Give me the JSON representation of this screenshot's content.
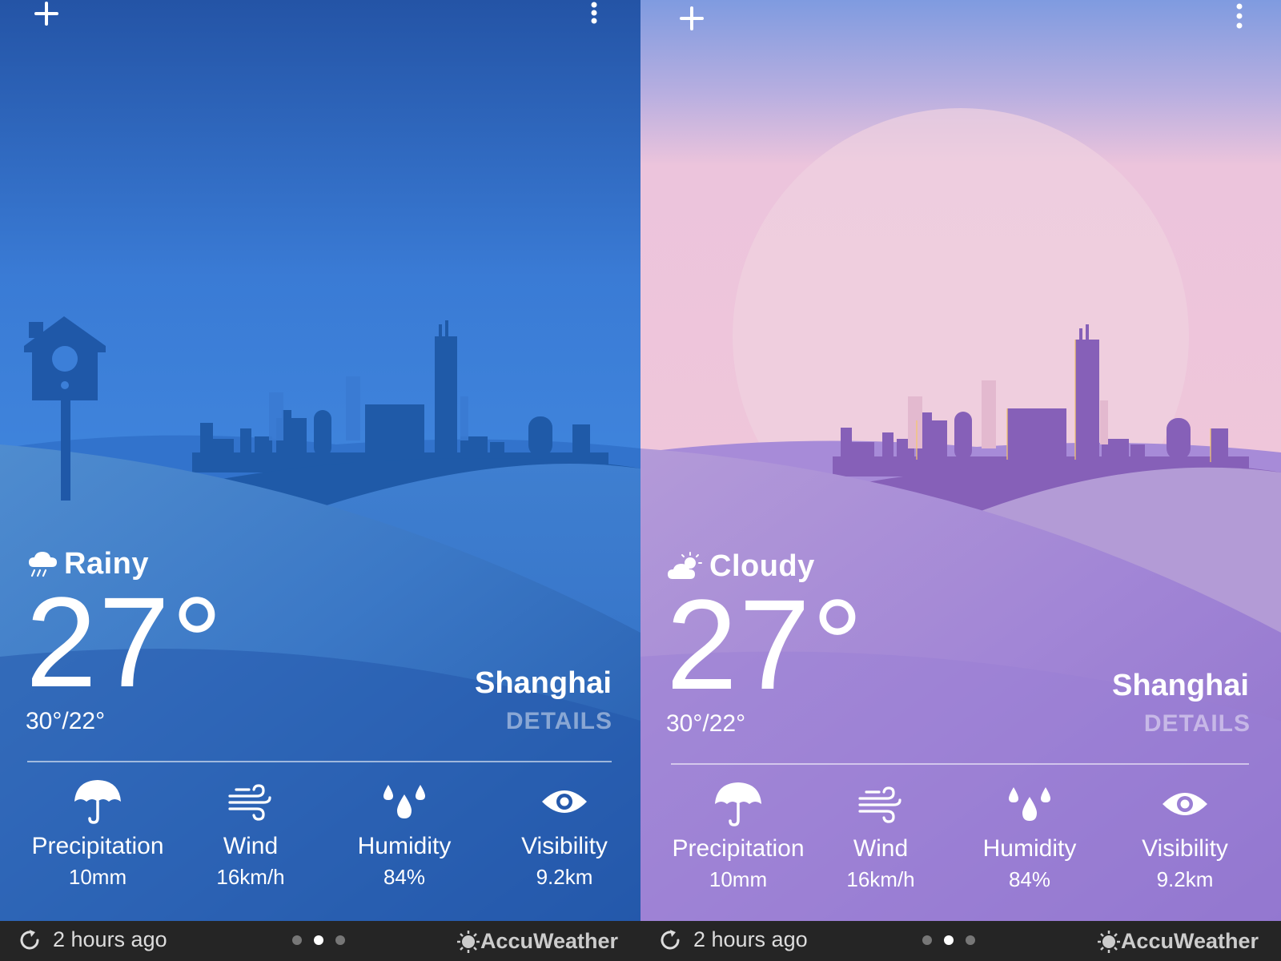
{
  "screens": [
    {
      "condition": "Rainy",
      "condition_icon": "rain-cloud-icon",
      "temperature": "27°",
      "high_low": "30°/22°",
      "city": "Shanghai",
      "details_label": "DETAILS",
      "metrics": [
        {
          "label": "Precipitation",
          "value": "10mm",
          "icon": "umbrella-icon"
        },
        {
          "label": "Wind",
          "value": "16km/h",
          "icon": "wind-icon"
        },
        {
          "label": "Humidity",
          "value": "84%",
          "icon": "humidity-icon"
        },
        {
          "label": "Visibility",
          "value": "9.2km",
          "icon": "eye-icon"
        }
      ],
      "footer": {
        "updated": "2 hours ago",
        "brand": "AccuWeather",
        "page_dots": 3,
        "active_dot": 2
      },
      "colors": {
        "sky_top": "#2454a6",
        "sky_mid": "#3f84dc",
        "hill": "#2a65b9",
        "city": "#1f5aa8",
        "footer": "#252525"
      }
    },
    {
      "condition": "Cloudy",
      "condition_icon": "partly-cloudy-icon",
      "temperature": "27°",
      "high_low": "30°/22°",
      "city": "Shanghai",
      "details_label": "DETAILS",
      "metrics": [
        {
          "label": "Precipitation",
          "value": "10mm",
          "icon": "umbrella-icon"
        },
        {
          "label": "Wind",
          "value": "16km/h",
          "icon": "wind-icon"
        },
        {
          "label": "Humidity",
          "value": "84%",
          "icon": "humidity-icon"
        },
        {
          "label": "Visibility",
          "value": "9.2km",
          "icon": "eye-icon"
        }
      ],
      "footer": {
        "updated": "2 hours ago",
        "brand": "AccuWeather",
        "page_dots": 3,
        "active_dot": 2
      },
      "colors": {
        "sky_top": "#8aa4e0",
        "sky_mid": "#efc7d9",
        "hill": "#9b7fd2",
        "city": "#8660b8",
        "footer": "#252525"
      }
    }
  ]
}
